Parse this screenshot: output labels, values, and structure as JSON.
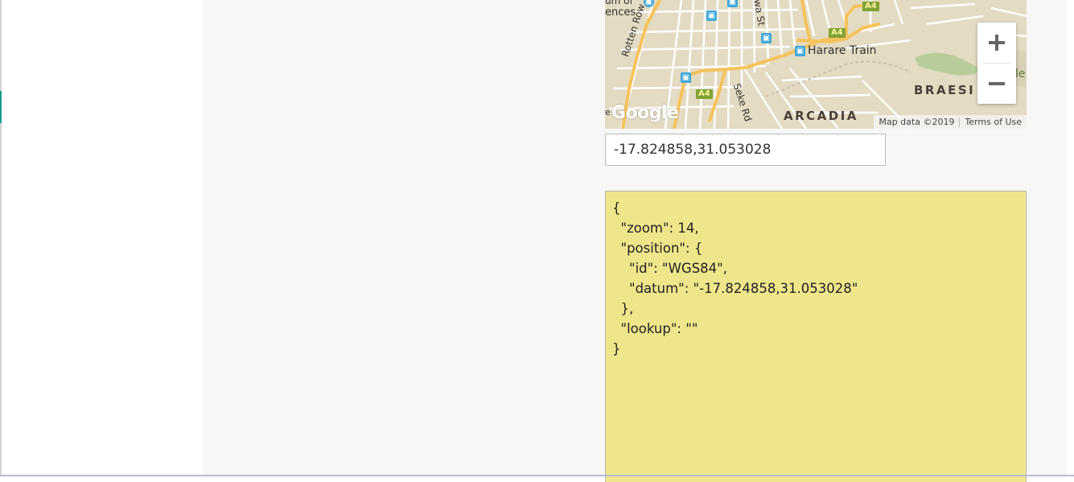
{
  "map": {
    "labels": {
      "sciences_partial": "ences",
      "sciences_partial_top": "um of",
      "rotten_row": "Rotten Row",
      "seke_rd": "Seke Rd",
      "harare_train": "Harare Train",
      "braeside": "BRAESI",
      "arcadia": "ARCADIA",
      "street_top": "wa St",
      "partial_right": "le",
      "partial_left": "e"
    },
    "shields": [
      "A4",
      "A4",
      "A4"
    ],
    "google_logo": "Google",
    "attribution": {
      "map_data": "Map data ©2019",
      "terms": "Terms of Use"
    },
    "zoom_in_label": "Zoom in",
    "zoom_out_label": "Zoom out",
    "colors": {
      "land": "#e3dbc2",
      "road_major": "#f7c25b",
      "road_minor": "#ffffff",
      "park": "#b7cc9a",
      "transit": "#3aa6d9"
    }
  },
  "coordinate_input": {
    "value": "-17.824858,31.053028"
  },
  "json_output": {
    "text": "{\n  \"zoom\": 14,\n  \"position\": {\n    \"id\": \"WGS84\",\n    \"datum\": \"-17.824858,31.053028\"\n  },\n  \"lookup\": \"\"\n}"
  }
}
